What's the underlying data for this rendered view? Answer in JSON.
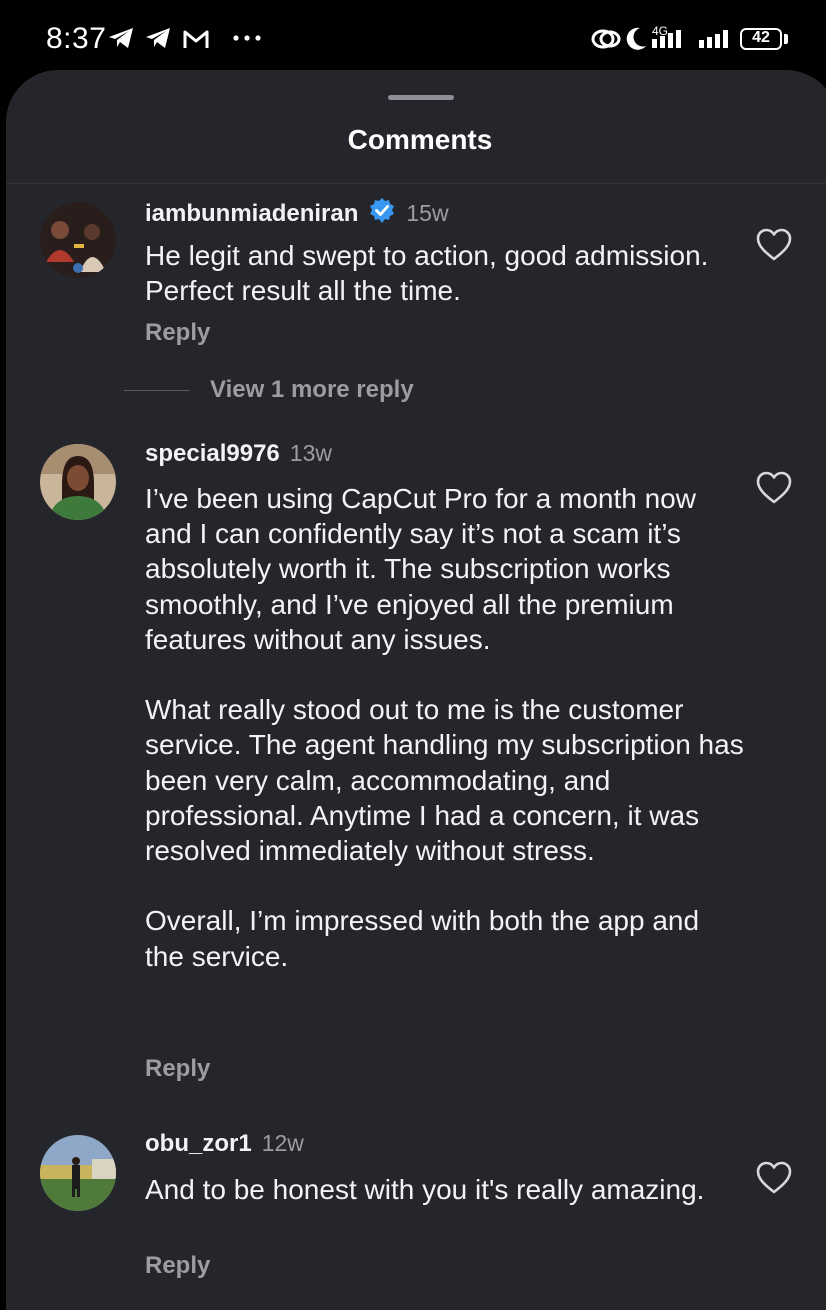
{
  "status_bar": {
    "time": "8:37",
    "network": "4G",
    "battery": "42",
    "icons": [
      "telegram-icon",
      "telegram-icon",
      "gmail-icon",
      "more-dots-icon",
      "hotspot-icon",
      "moon-icon",
      "signal-icon",
      "signal-icon",
      "battery-icon"
    ]
  },
  "sheet": {
    "title": "Comments"
  },
  "comments": [
    {
      "username": "iambunmiadeniran",
      "verified": true,
      "age": "15w",
      "text": "He legit and swept to action, good admission. Perfect result all the time.",
      "reply_label": "Reply",
      "view_more": "View 1 more reply"
    },
    {
      "username": "special9976",
      "verified": false,
      "age": "13w",
      "text": "I’ve been using CapCut Pro for a month now and I can confidently say it’s not a scam it’s absolutely worth it. The subscription works smoothly, and I’ve enjoyed all the premium features without any issues.\n\nWhat really stood out to me is the customer service. The agent handling my subscription has been very calm, accommodating, and professional. Anytime I had a concern, it was resolved immediately without stress.\n\nOverall, I’m impressed with both the app and the service.",
      "reply_label": "Reply"
    },
    {
      "username": "obu_zor1",
      "verified": false,
      "age": "12w",
      "text": "And to be honest with you it's really amazing.",
      "reply_label": "Reply"
    }
  ],
  "colors": {
    "sheet_bg": "#25262b",
    "text_primary": "#f3f3f5",
    "text_secondary": "#9c9da3",
    "verified_blue": "#3897f0"
  }
}
